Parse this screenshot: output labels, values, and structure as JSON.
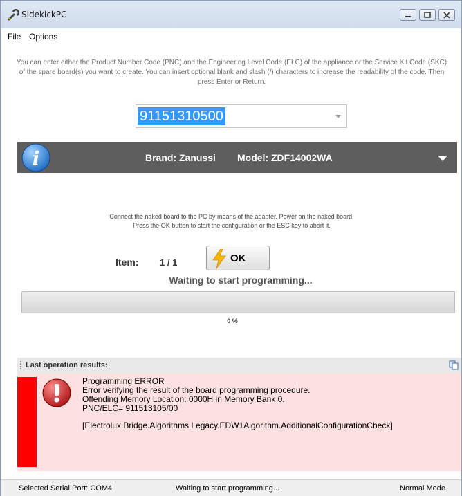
{
  "window": {
    "title": "SidekickPC"
  },
  "menu": {
    "file": "File",
    "options": "Options"
  },
  "instructions": "You can enter either the Product Number Code (PNC) and the Engineering Level Code (ELC) of the appliance or the Service Kit Code (SKC) of the spare board(s) you want to create. You can insert optional blank and slash (/) characters to increase the readability of the code. Then press Enter or Return.",
  "code_input": {
    "value": "91151310500"
  },
  "brand_bar": {
    "brand": "Brand: Zanussi",
    "model": "Model: ZDF14002WA"
  },
  "connect_message": {
    "line1": "Connect the naked board to the PC by means of the adapter. Power on the naked board.",
    "line2": "Press the OK button to start the configuration or the ESC key to abort it."
  },
  "item": {
    "label": "Item:",
    "value": "1 / 1"
  },
  "ok_button": {
    "label": "OK"
  },
  "status_text": "Waiting to start programming...",
  "progress": {
    "fraction": 0,
    "label": "0 %"
  },
  "results": {
    "header": "Last operation results:",
    "lines": [
      "Programming ERROR",
      "Error verifying the result of the board programming procedure.",
      "Offending Memory Location: 0000H in Memory Bank 0.",
      "PNC/ELC= 911513105/00",
      "[Electrolux.Bridge.Algorithms.Legacy.EDW1Algorithm.AdditionalConfigurationCheck]"
    ]
  },
  "statusbar": {
    "port": "Selected Serial Port: COM4",
    "message": "Waiting to start programming...",
    "mode": "Normal Mode"
  },
  "colors": {
    "selection": "#3399ff",
    "brand_bar": "#5e5e5e",
    "error_panel": "#fde0e0",
    "error_strip": "#ff0000"
  }
}
